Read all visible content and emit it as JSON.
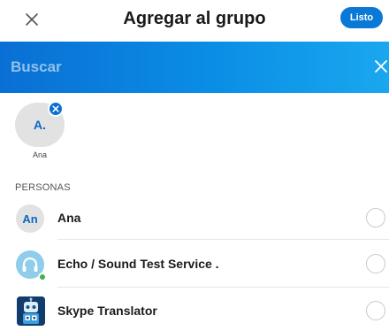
{
  "header": {
    "title": "Agregar al grupo",
    "done_label": "Listo"
  },
  "search": {
    "placeholder": "Buscar"
  },
  "selected": [
    {
      "initials": "A.",
      "name": "Ana"
    }
  ],
  "section_label": "PERSONAS",
  "contacts": [
    {
      "name": "Ana",
      "avatar_text": "An",
      "avatar_type": "initials",
      "selected": false
    },
    {
      "name": "Echo / Sound Test Service .",
      "avatar_type": "echo-icon",
      "status": "online",
      "selected": false
    },
    {
      "name": "Skype Translator",
      "avatar_type": "bot-icon",
      "selected": false
    }
  ],
  "colors": {
    "accent": "#0a78d6",
    "online": "#3ab44a",
    "initials_text": "#0b66c2"
  }
}
